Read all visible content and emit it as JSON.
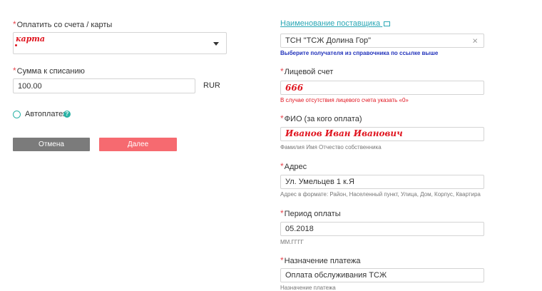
{
  "left": {
    "pay_from": {
      "label": "Оплатить со счета / карты",
      "value": "карта"
    },
    "amount": {
      "label": "Сумма к списанию",
      "value": "100.00",
      "currency": "RUR"
    },
    "autopay": {
      "label": "Автоплатеж",
      "help": "?"
    },
    "buttons": {
      "cancel": "Отмена",
      "next": "Далее"
    }
  },
  "right": {
    "provider": {
      "link": "Наименование поставщика",
      "value": "ТСН \"ТСЖ Долина Гор\"",
      "clear": "×",
      "hint": "Выберите получателя из справочника по ссылке выше"
    },
    "account": {
      "label": "Лицевой счет",
      "value": "666",
      "hint": "В случае отсутствия лицевого счета указать «0»"
    },
    "fio": {
      "label": "ФИО (за кого оплата)",
      "value": "Иванов Иван Иванович",
      "hint": "Фамилия Имя Отчество собственника"
    },
    "address": {
      "label": "Адрес",
      "value": "Ул. Умельцев 1 к.Я",
      "hint": "Адрес в формате: Район, Населенный пункт, Улица, Дом, Корпус, Квартира"
    },
    "period": {
      "label": "Период оплаты",
      "value": "05.2018",
      "hint": "ММ.ГГГГ"
    },
    "purpose": {
      "label": "Назначение платежа",
      "value": "Оплата обслуживания ТСЖ",
      "hint": "Назначение платежа"
    }
  },
  "colors": {
    "required": "#e8464e",
    "link": "#2aa7b5",
    "provider_hint": "#2233bb",
    "error_hint": "#e0151f",
    "cancel_btn": "#7b7b7b",
    "next_btn": "#f66a70",
    "autopay_radio": "#2bb3a6"
  }
}
